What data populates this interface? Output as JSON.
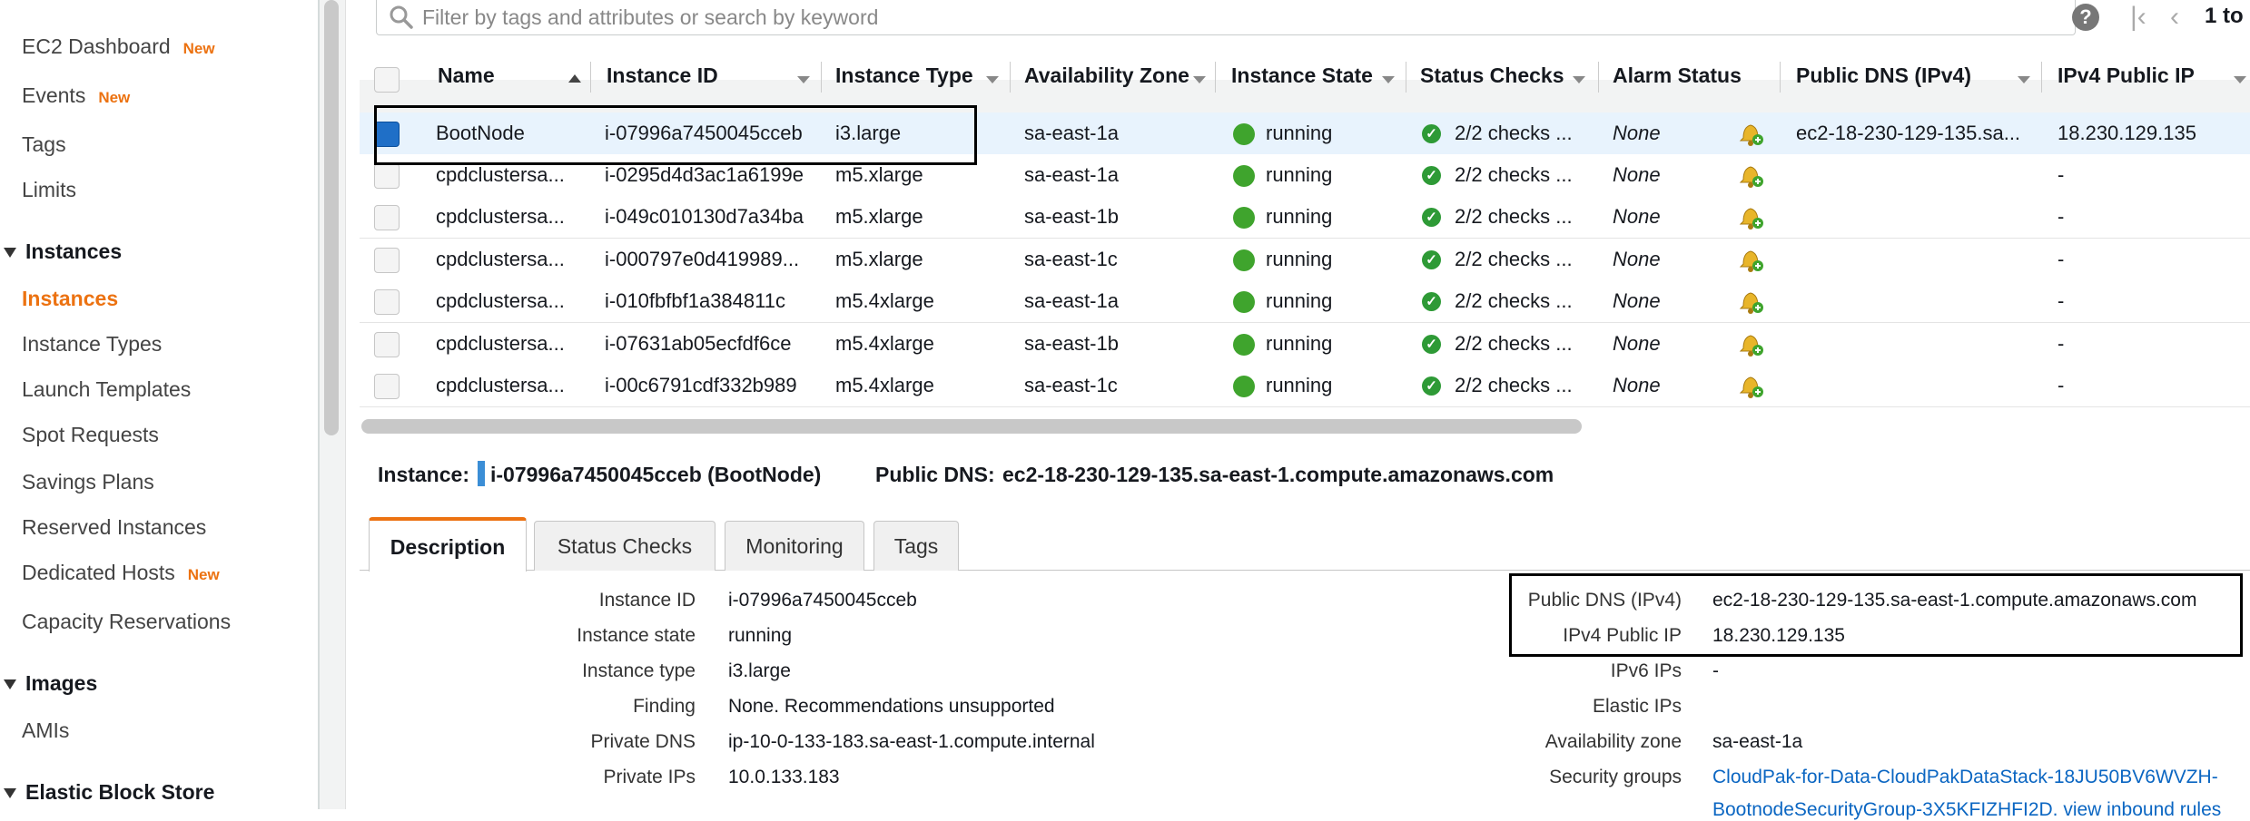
{
  "sidebar": {
    "items": [
      {
        "label": "EC2 Dashboard",
        "badge": "New"
      },
      {
        "label": "Events",
        "badge": "New"
      },
      {
        "label": "Tags"
      },
      {
        "label": "Limits"
      }
    ],
    "sections": [
      {
        "title": "Instances",
        "items": [
          {
            "label": "Instances",
            "active": true
          },
          {
            "label": "Instance Types"
          },
          {
            "label": "Launch Templates"
          },
          {
            "label": "Spot Requests"
          },
          {
            "label": "Savings Plans"
          },
          {
            "label": "Reserved Instances"
          },
          {
            "label": "Dedicated Hosts",
            "badge": "New"
          },
          {
            "label": "Capacity Reservations"
          }
        ]
      },
      {
        "title": "Images",
        "items": [
          {
            "label": "AMIs"
          }
        ]
      },
      {
        "title": "Elastic Block Store",
        "items": []
      }
    ]
  },
  "filter": {
    "placeholder": "Filter by tags and attributes or search by keyword"
  },
  "pager": {
    "text": "1 to"
  },
  "table": {
    "columns": [
      "Name",
      "Instance ID",
      "Instance Type",
      "Availability Zone",
      "Instance State",
      "Status Checks",
      "Alarm Status",
      "Public DNS (IPv4)",
      "IPv4 Public IP"
    ],
    "rows": [
      {
        "name": "BootNode",
        "id": "i-07996a7450045cceb",
        "type": "i3.large",
        "az": "sa-east-1a",
        "state": "running",
        "checks": "2/2 checks ...",
        "alarm": "None",
        "dns": "ec2-18-230-129-135.sa...",
        "ip": "18.230.129.135",
        "selected": true
      },
      {
        "name": "cpdclustersa...",
        "id": "i-0295d4d3ac1a6199e",
        "type": "m5.xlarge",
        "az": "sa-east-1a",
        "state": "running",
        "checks": "2/2 checks ...",
        "alarm": "None",
        "dns": "",
        "ip": "-"
      },
      {
        "name": "cpdclustersa...",
        "id": "i-049c010130d7a34ba",
        "type": "m5.xlarge",
        "az": "sa-east-1b",
        "state": "running",
        "checks": "2/2 checks ...",
        "alarm": "None",
        "dns": "",
        "ip": "-"
      },
      {
        "name": "cpdclustersa...",
        "id": "i-000797e0d419989...",
        "type": "m5.xlarge",
        "az": "sa-east-1c",
        "state": "running",
        "checks": "2/2 checks ...",
        "alarm": "None",
        "dns": "",
        "ip": "-"
      },
      {
        "name": "cpdclustersa...",
        "id": "i-010fbfbf1a384811c",
        "type": "m5.4xlarge",
        "az": "sa-east-1a",
        "state": "running",
        "checks": "2/2 checks ...",
        "alarm": "None",
        "dns": "",
        "ip": "-"
      },
      {
        "name": "cpdclustersa...",
        "id": "i-07631ab05ecfdf6ce",
        "type": "m5.4xlarge",
        "az": "sa-east-1b",
        "state": "running",
        "checks": "2/2 checks ...",
        "alarm": "None",
        "dns": "",
        "ip": "-"
      },
      {
        "name": "cpdclustersa...",
        "id": "i-00c6791cdf332b989",
        "type": "m5.4xlarge",
        "az": "sa-east-1c",
        "state": "running",
        "checks": "2/2 checks ...",
        "alarm": "None",
        "dns": "",
        "ip": "-"
      }
    ]
  },
  "detail": {
    "instance_label": "Instance:",
    "instance_value": "i-07996a7450045cceb (BootNode)",
    "dns_label": "Public DNS:",
    "dns_value": "ec2-18-230-129-135.sa-east-1.compute.amazonaws.com",
    "tabs": [
      "Description",
      "Status Checks",
      "Monitoring",
      "Tags"
    ],
    "left_fields": [
      {
        "label": "Instance ID",
        "value": "i-07996a7450045cceb"
      },
      {
        "label": "Instance state",
        "value": "running"
      },
      {
        "label": "Instance type",
        "value": "i3.large"
      },
      {
        "label": "Finding",
        "value": "None. Recommendations unsupported"
      },
      {
        "label": "Private DNS",
        "value": "ip-10-0-133-183.sa-east-1.compute.internal"
      },
      {
        "label": "Private IPs",
        "value": "10.0.133.183"
      }
    ],
    "right_fields": [
      {
        "label": "Public DNS (IPv4)",
        "value": "ec2-18-230-129-135.sa-east-1.compute.amazonaws.com"
      },
      {
        "label": "IPv4 Public IP",
        "value": "18.230.129.135"
      },
      {
        "label": "IPv6 IPs",
        "value": "-"
      },
      {
        "label": "Elastic IPs",
        "value": ""
      },
      {
        "label": "Availability zone",
        "value": "sa-east-1a"
      },
      {
        "label": "Security groups",
        "value": "CloudPak-for-Data-CloudPakDataStack-18JU50BV6WVZH-",
        "value2": "BootnodeSecurityGroup-3X5KFIZHFI2D. view inbound rules"
      }
    ]
  },
  "colors": {
    "accent": "#ec7211",
    "link": "#0b66c2",
    "running": "#3fa42d",
    "selection": "#e8f3fd"
  },
  "icons": [
    "search-icon",
    "help-icon",
    "first-page-icon",
    "prev-page-icon",
    "sort-asc-icon",
    "running-status-icon",
    "check-passed-icon",
    "alarm-bell-icon"
  ]
}
